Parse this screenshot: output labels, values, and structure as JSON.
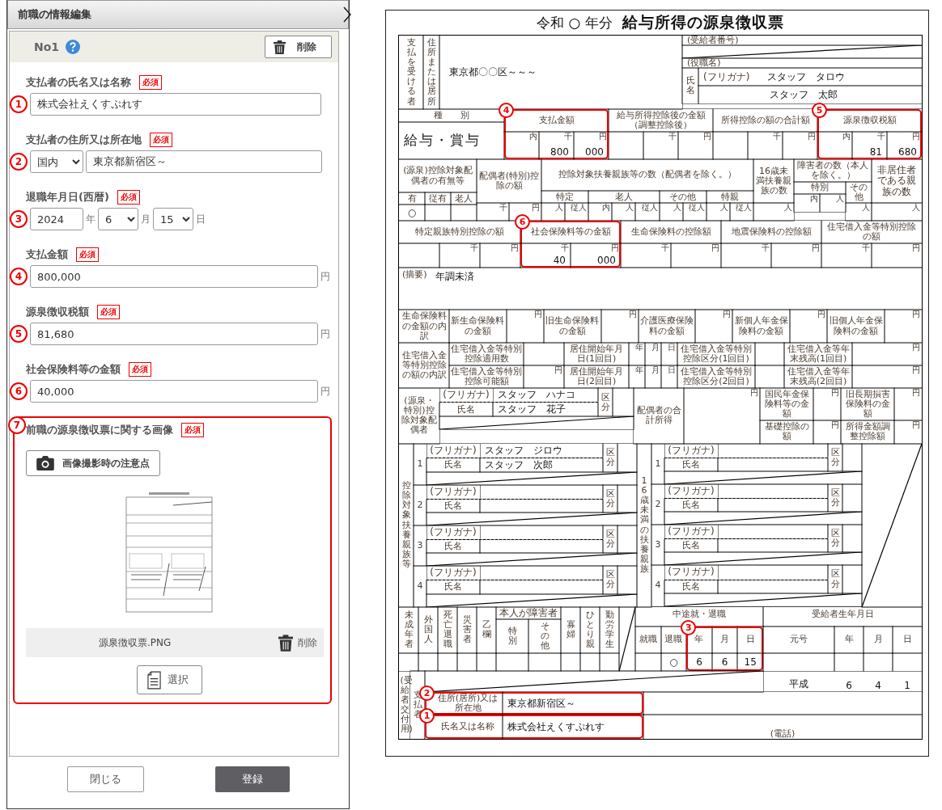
{
  "panel": {
    "title": "前職の情報編集",
    "entry": {
      "number": "No1",
      "delete_label": "削除"
    },
    "fields": [
      {
        "kind": "text",
        "marker": "1",
        "label": "支払者の氏名又は名称",
        "required": "必須",
        "value": "株式会社えくすぷれす"
      },
      {
        "kind": "address",
        "marker": "2",
        "label": "支払者の住所又は所在地",
        "required": "必須",
        "region": "国内",
        "value": "東京都新宿区～"
      },
      {
        "kind": "date",
        "marker": "3",
        "label": "退職年月日(西暦)",
        "required": "必須",
        "year": "2024",
        "year_unit": "年",
        "month": "6",
        "month_unit": "月",
        "day": "15",
        "day_unit": "日"
      },
      {
        "kind": "amount",
        "marker": "4",
        "label": "支払金額",
        "required": "必須",
        "value": "800,000",
        "unit": "円"
      },
      {
        "kind": "amount",
        "marker": "5",
        "label": "源泉徴収税額",
        "required": "必須",
        "value": "81,680",
        "unit": "円"
      },
      {
        "kind": "amount",
        "marker": "6",
        "label": "社会保険料等の金額",
        "required": "必須",
        "value": "40,000",
        "unit": "円"
      }
    ],
    "image_field": {
      "marker": "7",
      "highlighted": true,
      "label": "前職の源泉徴収票に関する画像",
      "required": "必須",
      "guide_button": "画像撮影時の注意点",
      "file_name": "源泉徴収票.PNG",
      "delete_label": "削除",
      "select_button": "選択"
    },
    "footer": {
      "close": "閉じる",
      "submit": "登録"
    }
  },
  "slip": {
    "year": "令和 ○ 年分",
    "title": "給与所得の源泉徴収票",
    "recipient": {
      "label": "支払を受ける者",
      "address_label": "住所または居所",
      "address": "東京都〇〇区～～～",
      "number_label": "(受給者番号)",
      "position_label": "(役職名)",
      "name_label": "氏名",
      "kana_label": "(フリガナ)",
      "kana": "スタッフ　タロウ",
      "name": "スタッフ　太郎"
    },
    "type": {
      "header": "種　　別",
      "value": "給与・賞与"
    },
    "amounts": [
      {
        "header": "支払金額",
        "marker": "4",
        "cells": [
          {
            "kind": "unit",
            "unit": "内"
          },
          {
            "kind": "unit",
            "unit": "千",
            "value": "800"
          },
          {
            "kind": "unit",
            "unit": "円",
            "value": "000"
          }
        ]
      },
      {
        "header": "給与所得控除後の金額（調整控除後）",
        "cells": [
          {
            "kind": "blank"
          },
          {
            "kind": "unit",
            "unit": "千"
          },
          {
            "kind": "unit",
            "unit": "円"
          }
        ]
      },
      {
        "header": "所得控除の額の合計額",
        "cells": [
          {
            "kind": "blank"
          },
          {
            "kind": "unit",
            "unit": "千"
          },
          {
            "kind": "unit",
            "unit": "円"
          }
        ]
      },
      {
        "header": "源泉徴収税額",
        "marker": "5",
        "cells": [
          {
            "kind": "unit",
            "unit": "内"
          },
          {
            "kind": "unit",
            "unit": "千",
            "value": "81"
          },
          {
            "kind": "unit",
            "unit": "円",
            "value": "680"
          }
        ]
      }
    ],
    "counts": {
      "spouse": {
        "header": "(源泉)控除対象配偶者の有無等",
        "subs": [
          {
            "label": "有",
            "value": "○"
          },
          {
            "label": "従有"
          },
          {
            "label": "老人"
          }
        ]
      },
      "spouse_deduction": {
        "header": "配偶者(特別)控除の額",
        "units": [
          "千",
          "円"
        ]
      },
      "dependents": {
        "header": "控除対象扶養親族等の数（配偶者を除く。）",
        "groups": [
          {
            "label": "特定",
            "units": [
              "人",
              "従人"
            ]
          },
          {
            "label": "老人",
            "units": [
              "内",
              "人",
              "従人"
            ]
          },
          {
            "label": "その他",
            "units": [
              "人",
              "従人"
            ]
          },
          {
            "label": "特親",
            "units": [
              "人",
              "従人"
            ]
          }
        ]
      },
      "under16": {
        "header": "16歳未満扶養親族の数",
        "units": [
          "人"
        ]
      },
      "disabled": {
        "header": "障害者の数（本人を除く。）",
        "groups": [
          {
            "label": "特別",
            "units": [
              "内",
              "人"
            ]
          },
          {
            "label": "その他",
            "units": [
              "人"
            ]
          }
        ]
      },
      "nonresident": {
        "header": "非居住者である親族の数",
        "units": [
          "人"
        ]
      }
    },
    "deductions": [
      {
        "header": "特定親族特別控除の額",
        "cells": [
          {
            "kind": "blank"
          },
          {
            "kind": "unit",
            "unit": "千"
          },
          {
            "kind": "unit",
            "unit": "円"
          }
        ]
      },
      {
        "header": "社会保険料等の金額",
        "marker": "6",
        "cells": [
          {
            "kind": "unit",
            "unit": "千",
            "value": "40"
          },
          {
            "kind": "unit",
            "unit": "円",
            "value": "000"
          }
        ]
      },
      {
        "header": "生命保険料の控除額",
        "cells": [
          {
            "kind": "unit",
            "unit": "千"
          },
          {
            "kind": "unit",
            "unit": "円"
          }
        ]
      },
      {
        "header": "地震保険料の控除額",
        "cells": [
          {
            "kind": "unit",
            "unit": "千"
          },
          {
            "kind": "unit",
            "unit": "円"
          }
        ]
      },
      {
        "header": "住宅借入金等特別控除の額",
        "cells": [
          {
            "kind": "unit",
            "unit": "千"
          },
          {
            "kind": "unit",
            "unit": "円"
          }
        ]
      }
    ],
    "remarks": {
      "label": "(摘要)",
      "text": "年調未済"
    },
    "insurance": {
      "label": "生命保険料の金額の内訳",
      "items": [
        {
          "label": "新生命保険料の金額",
          "unit": "円"
        },
        {
          "label": "旧生命保険料の金額",
          "unit": "円"
        },
        {
          "label": "介護医療保険料の金額",
          "unit": "円"
        },
        {
          "label": "新個人年金保険料の金額",
          "unit": "円"
        },
        {
          "label": "旧個人年金保険料の金額",
          "unit": "円"
        }
      ]
    },
    "housing": {
      "label": "住宅借入金等特別控除の額の内訳",
      "rows": [
        {
          "label": "住宅借入金等特別控除適用数",
          "start_label": "居住開始年月日(1回目)",
          "date_units": [
            "年",
            "月",
            "日"
          ],
          "class_label": "住宅借入金等特別控除区分(1回目)",
          "balance_label": "住宅借入金等年末残高(1回目)",
          "balance_unit": "円"
        },
        {
          "label": "住宅借入金等特別控除可能額",
          "unit": "円",
          "start_label": "居住開始年月日(2回目)",
          "date_units": [
            "年",
            "月",
            "日"
          ],
          "class_label": "住宅借入金等特別控除区分(2回目)",
          "balance_label": "住宅借入金等年末残高(2回目)",
          "balance_unit": "円"
        }
      ]
    },
    "spouse": {
      "label": "(源泉・特別)控除対象配偶者",
      "kana_label": "(フリガナ)",
      "kana": "スタッフ　ハナコ",
      "name_label": "氏名",
      "name": "スタッフ　花子",
      "class_label": "区分",
      "income_label": "配偶者の合計所得",
      "income_unit": "円",
      "others": [
        {
          "label": "国民年金保険料等の金額",
          "unit": "円"
        },
        {
          "label": "旧長期損害保険料の金額",
          "unit": "円"
        },
        {
          "label": "基礎控除の額",
          "unit": "円"
        },
        {
          "label": "所得金額調整控除額",
          "unit": "円"
        }
      ]
    },
    "dependents": {
      "label": "控除対象扶養親族等",
      "entries": [
        {
          "number": "1",
          "kana_label": "(フリガナ)",
          "kana": "スタッフ　ジロウ",
          "name_label": "氏名",
          "name": "スタッフ　次郎",
          "class_label": "区分"
        },
        {
          "number": "2",
          "kana_label": "(フリガナ)",
          "name_label": "氏名",
          "class_label": "区分"
        },
        {
          "number": "3",
          "kana_label": "(フリガナ)",
          "name_label": "氏名",
          "class_label": "区分"
        },
        {
          "number": "4",
          "kana_label": "(フリガナ)",
          "name_label": "氏名",
          "class_label": "区分"
        }
      ]
    },
    "children": {
      "label": "16歳未満の扶養親族",
      "entries": [
        {
          "number": "1",
          "kana_label": "(フリガナ)",
          "name_label": "氏名",
          "class_label": "区分"
        },
        {
          "number": "2",
          "kana_label": "(フリガナ)",
          "name_label": "氏名",
          "class_label": "区分"
        },
        {
          "number": "3",
          "kana_label": "(フリガナ)",
          "name_label": "氏名",
          "class_label": "区分"
        },
        {
          "number": "4",
          "kana_label": "(フリガナ)",
          "name_label": "氏名",
          "class_label": "区分"
        }
      ]
    },
    "status": [
      {
        "label": "未成年者"
      },
      {
        "label": "外国人"
      },
      {
        "label": "死亡退職"
      },
      {
        "label": "災害者"
      },
      {
        "label": "乙欄"
      },
      {
        "label": "本人が障害者",
        "subs": [
          "特別",
          "その他"
        ]
      },
      {
        "label": "寡婦"
      },
      {
        "label": "ひとり親"
      },
      {
        "label": "勤労学生"
      }
    ],
    "job_change": {
      "label": "中途就・退職",
      "marker": "3",
      "subs": [
        {
          "label": "就職"
        },
        {
          "label": "退職",
          "value": "○"
        },
        {
          "label": "年",
          "value": "6"
        },
        {
          "label": "月",
          "value": "6"
        },
        {
          "label": "日",
          "value": "15"
        }
      ]
    },
    "birth": {
      "label": "受給者生年月日",
      "subs": [
        "元号",
        "年",
        "月",
        "日"
      ],
      "values": [
        "平成",
        "6",
        "4",
        "1"
      ]
    },
    "payer": {
      "copy_label": "(受給者交付用)",
      "label": "支払者",
      "address_label": "住所(居所)又は所在地",
      "address": "東京都新宿区～",
      "address_marker": "2",
      "name_label": "氏名又は名称",
      "name": "株式会社えくすぷれす",
      "name_marker": "1",
      "phone_label": "(電話)"
    }
  }
}
